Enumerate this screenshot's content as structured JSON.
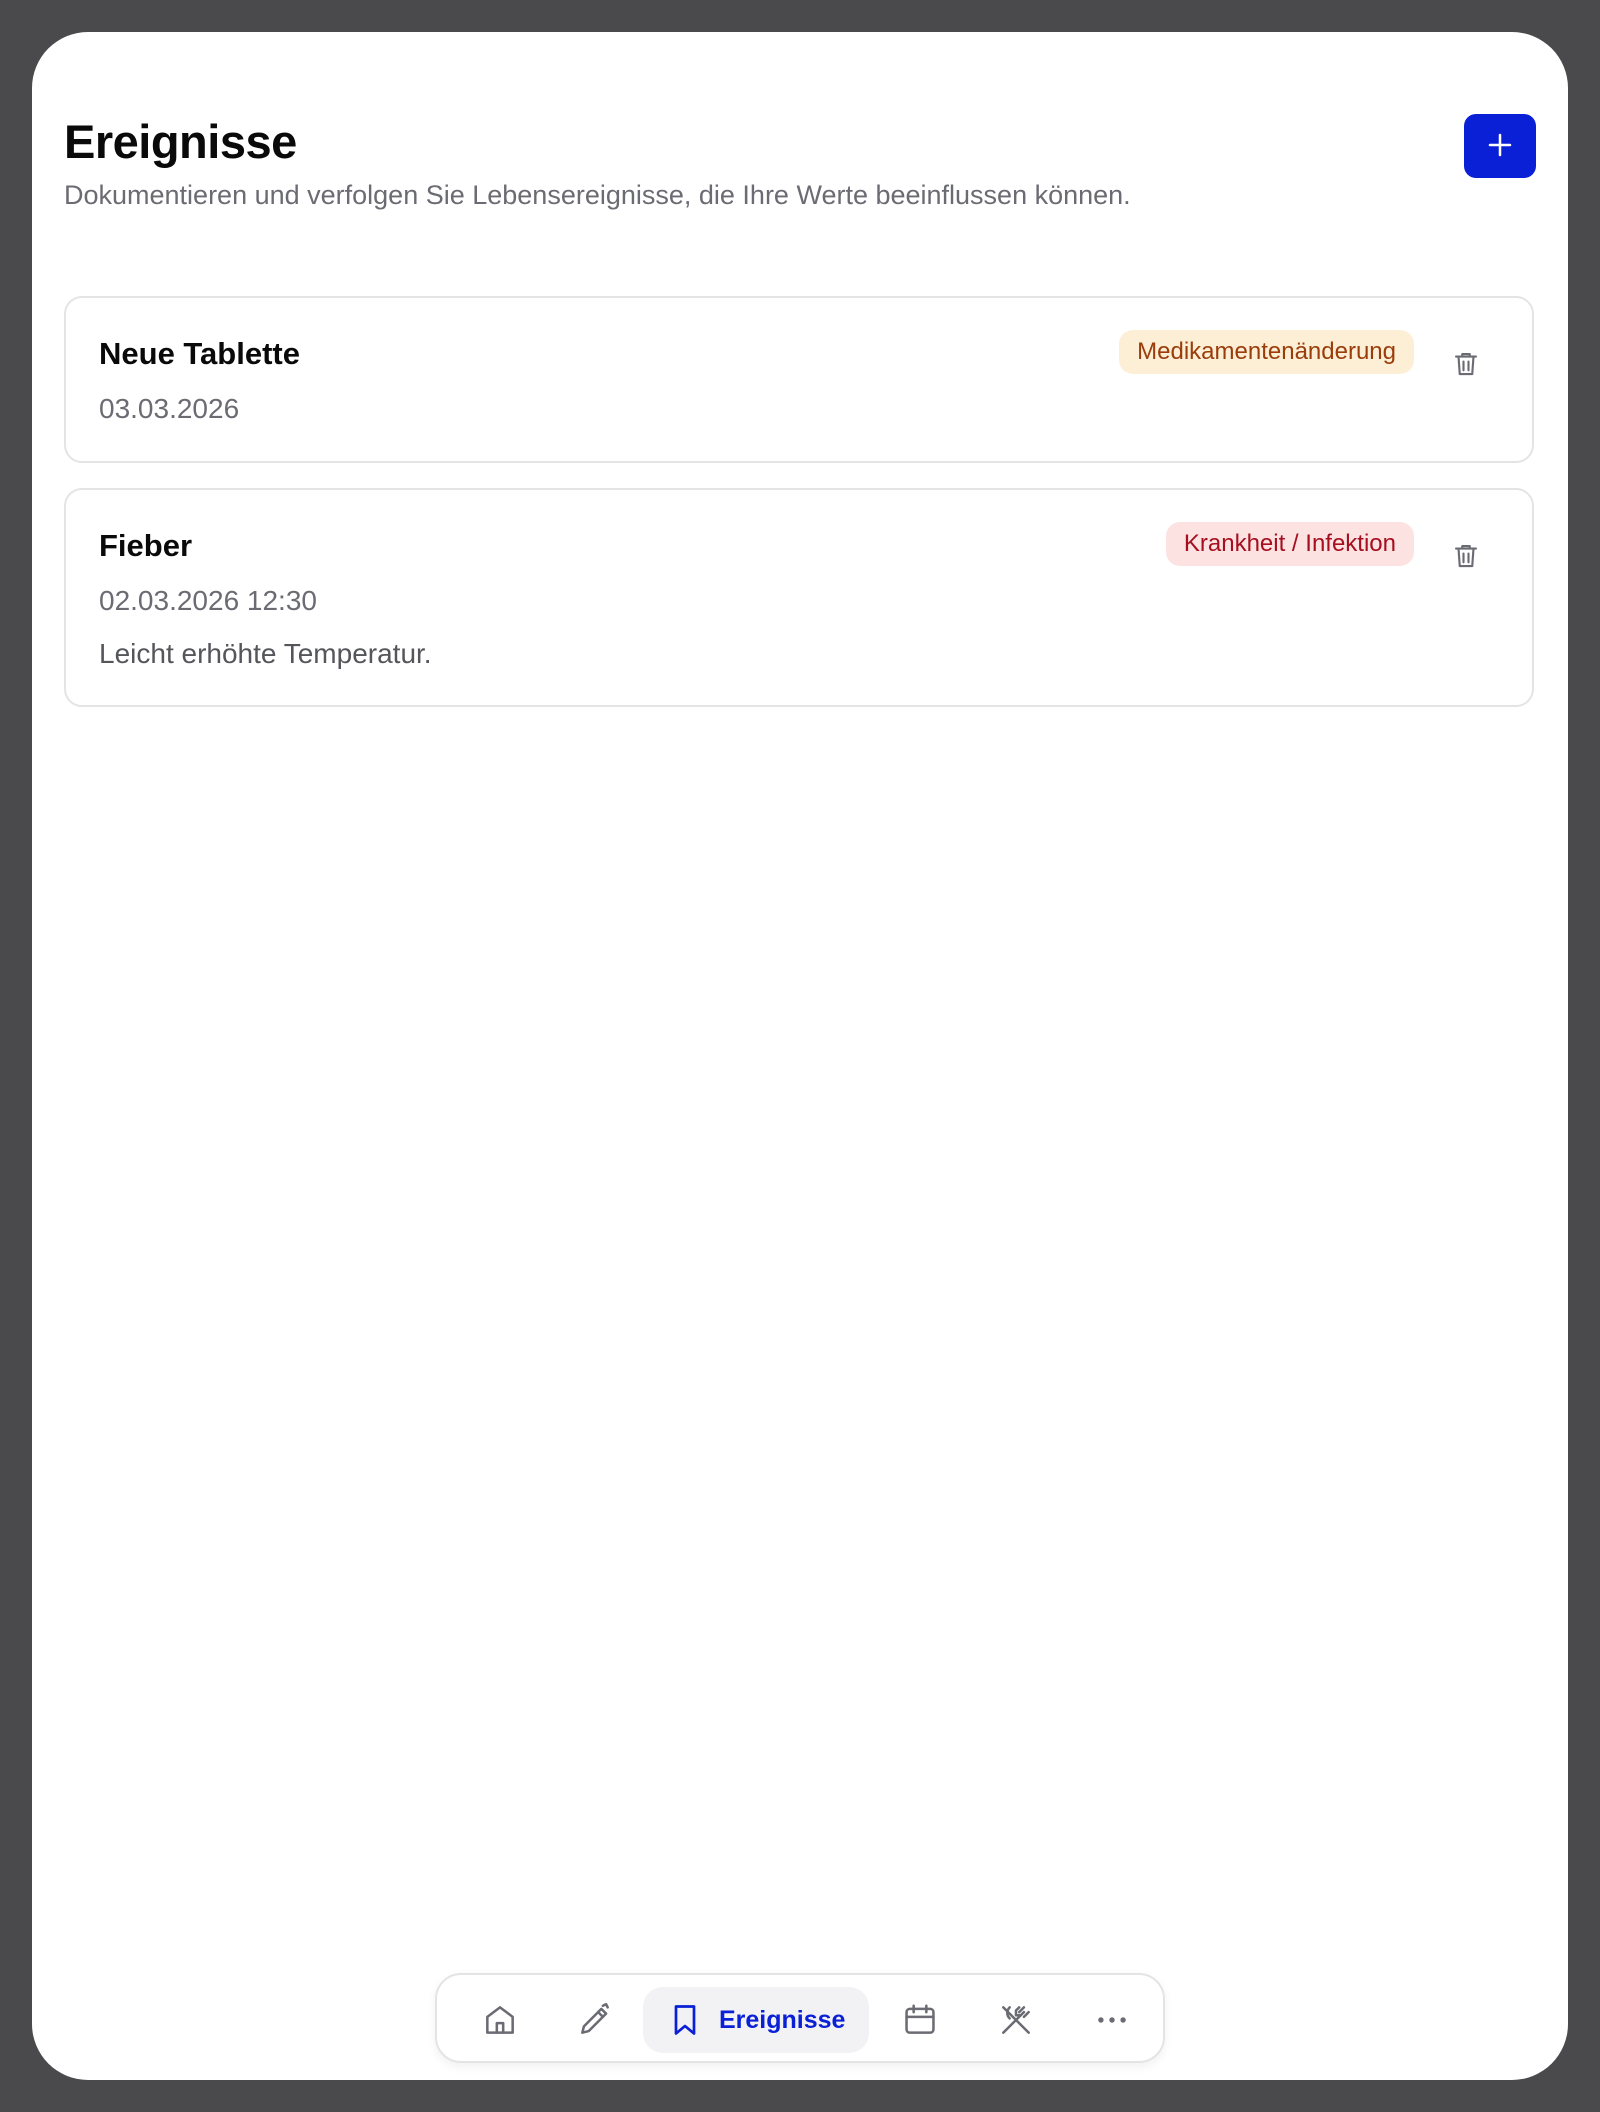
{
  "header": {
    "title": "Ereignisse",
    "subtitle": "Dokumentieren und verfolgen Sie Lebensereignisse, die Ihre Werte beeinflussen können.",
    "add_icon": "plus-icon"
  },
  "events": [
    {
      "title": "Neue Tablette",
      "date": "03.03.2026",
      "note": "",
      "tag": "Medikamentenänderung",
      "tag_color": "#fdeed6",
      "tag_text_color": "#9a3d0b",
      "delete_icon": "trash-icon"
    },
    {
      "title": "Fieber",
      "date": "02.03.2026 12:30",
      "note": "Leicht erhöhte Temperatur.",
      "tag": "Krankheit / Infektion",
      "tag_color": "#fde2e2",
      "tag_text_color": "#a50f1f",
      "delete_icon": "trash-icon"
    }
  ],
  "nav": {
    "items": [
      {
        "icon": "home-icon"
      },
      {
        "icon": "pen-icon"
      },
      {
        "icon": "bookmark-icon",
        "label": "Ereignisse",
        "active": true
      },
      {
        "icon": "calendar-icon"
      },
      {
        "icon": "fork-knife-crossed-icon"
      },
      {
        "icon": "more-dots-icon"
      }
    ]
  },
  "colors": {
    "accent": "#0a20d6",
    "frame": "#4a4a4d",
    "text_muted": "#6b6b73"
  }
}
